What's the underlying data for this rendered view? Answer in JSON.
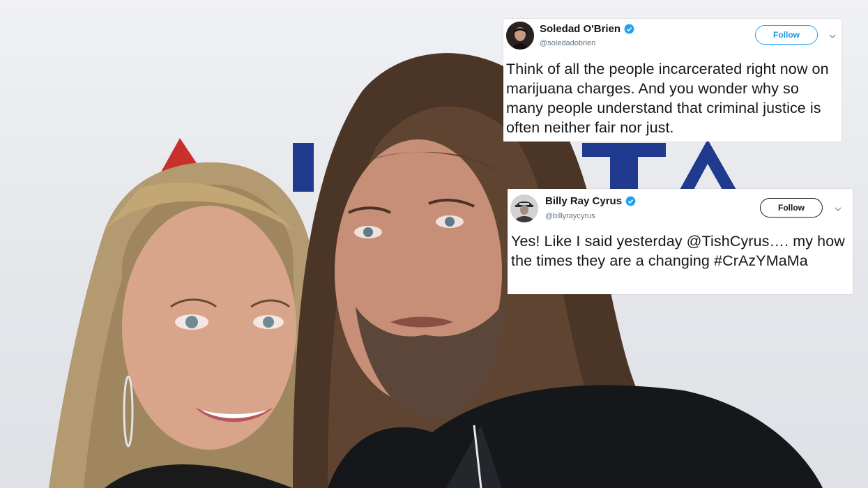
{
  "tweets": [
    {
      "name": "Soledad O'Brien",
      "handle": "@soledadobrien",
      "follow_label": "Follow",
      "text": "Think of all the people incarcerated right now on marijuana charges. And you wonder why so many people understand that criminal justice is often neither fair nor just."
    },
    {
      "name": "Billy Ray Cyrus",
      "handle": "@billyraycyrus",
      "follow_label": "Follow",
      "text": "Yes! Like I said yesterday @TishCyrus…. my how the times they are a changing #CrAzYMaMa"
    }
  ],
  "colors": {
    "twitter_blue": "#1da1f2",
    "backdrop_logo_blue": "#1f3a8f",
    "backdrop_logo_red": "#c8302b"
  },
  "icons": [
    "verified-badge-icon",
    "chevron-down-icon"
  ]
}
